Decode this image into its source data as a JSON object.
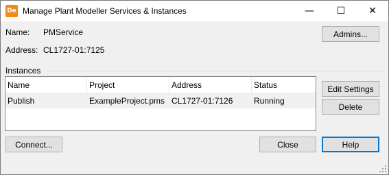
{
  "window": {
    "title": "Manage Plant Modeller Services & Instances",
    "app_icon_text": "De",
    "controls": {
      "minimize": "—",
      "maximize": "☐",
      "close": "✕"
    }
  },
  "service": {
    "name_label": "Name:",
    "name_value": "PMService",
    "address_label": "Address:",
    "address_value": "CL1727-01:7125"
  },
  "buttons": {
    "admins": "Admins...",
    "edit_settings": "Edit Settings",
    "delete": "Delete",
    "connect": "Connect...",
    "close": "Close",
    "help": "Help"
  },
  "instances": {
    "group_label": "Instances",
    "columns": [
      "Name",
      "Project",
      "Address",
      "Status"
    ],
    "rows": [
      {
        "name": "Publish",
        "project": "ExampleProject.pms",
        "address": "CL1727-01:7126",
        "status": "Running"
      }
    ]
  },
  "colors": {
    "app_icon": "#f28a1b",
    "dialog_bg": "#f0f0f0",
    "default_button_border": "#0078d7"
  }
}
